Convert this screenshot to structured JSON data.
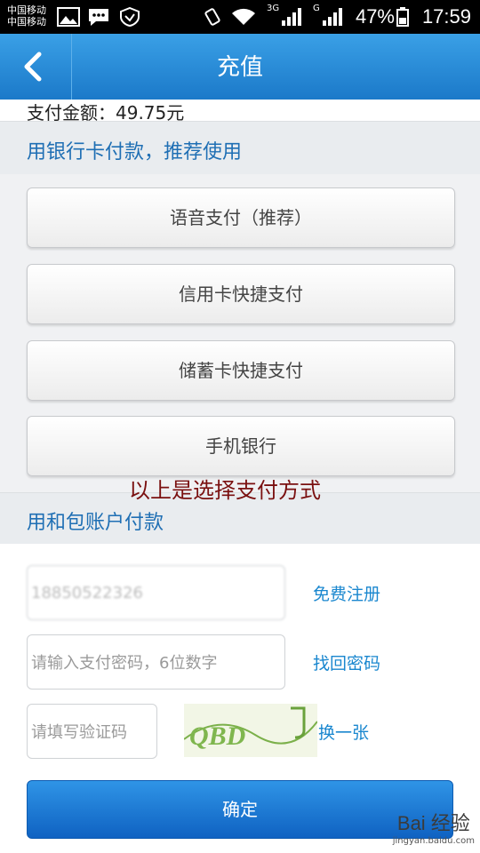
{
  "status_bar": {
    "carrier1": "中国移动",
    "carrier2": "中国移动",
    "network1": "3G",
    "network2": "G",
    "battery": "47%",
    "time": "17:59"
  },
  "header": {
    "title": "充值"
  },
  "payment": {
    "amount_label": "支付金额：49.75元"
  },
  "bank_section": {
    "label": "用银行卡付款，推荐使用",
    "options": [
      "语音支付（推荐）",
      "信用卡快捷支付",
      "储蓄卡快捷支付",
      "手机银行"
    ]
  },
  "annotation": "以上是选择支付方式",
  "wallet_section": {
    "label": "用和包账户付款",
    "phone_value": "18850522326",
    "register_link": "免费注册",
    "password_placeholder": "请输入支付密码，6位数字",
    "forgot_link": "找回密码",
    "captcha_placeholder": "请填写验证码",
    "captcha_text": "QBD",
    "refresh_link": "换一张"
  },
  "confirm_label": "确定",
  "watermark": {
    "line1": "Bai 经验",
    "line2": "jingyan.baidu.com"
  },
  "colors": {
    "accent": "#1b79c9",
    "link": "#1a87cf",
    "annotation": "#7a1010"
  }
}
